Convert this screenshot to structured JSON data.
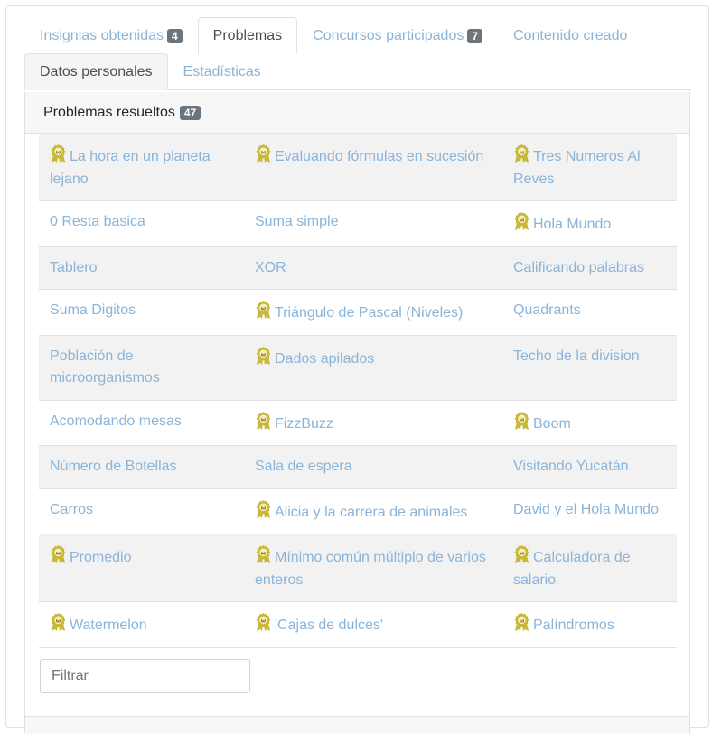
{
  "tabs": [
    {
      "label": "Insignias obtenidas",
      "badge": "4"
    },
    {
      "label": "Problemas"
    },
    {
      "label": "Concursos participados",
      "badge": "7"
    },
    {
      "label": "Contenido creado"
    },
    {
      "label": "Datos personales"
    },
    {
      "label": "Estadísticas"
    }
  ],
  "panel": {
    "title": "Problemas resueltos",
    "count": "47"
  },
  "rows": [
    [
      {
        "t": "La hora en un planeta lejano",
        "m": true
      },
      {
        "t": "Evaluando fórmulas en sucesión",
        "m": true
      },
      {
        "t": "Tres Numeros Al Reves",
        "m": true
      }
    ],
    [
      {
        "t": "0 Resta basica",
        "m": false
      },
      {
        "t": "Suma simple",
        "m": false
      },
      {
        "t": "Hola Mundo",
        "m": true
      }
    ],
    [
      {
        "t": "Tablero",
        "m": false
      },
      {
        "t": "XOR",
        "m": false
      },
      {
        "t": "Calificando palabras",
        "m": false
      }
    ],
    [
      {
        "t": "Suma Digitos",
        "m": false
      },
      {
        "t": "Triángulo de Pascal (Niveles)",
        "m": true
      },
      {
        "t": "Quadrants",
        "m": false
      }
    ],
    [
      {
        "t": "Población de microorganismos",
        "m": false
      },
      {
        "t": "Dados apilados",
        "m": true
      },
      {
        "t": "Techo de la division",
        "m": false
      }
    ],
    [
      {
        "t": "Acomodando mesas",
        "m": false
      },
      {
        "t": "FizzBuzz",
        "m": true
      },
      {
        "t": "Boom",
        "m": true
      }
    ],
    [
      {
        "t": "Número de Botellas",
        "m": false
      },
      {
        "t": "Sala de espera",
        "m": false
      },
      {
        "t": "Visitando Yucatán",
        "m": false
      }
    ],
    [
      {
        "t": "Carros",
        "m": false
      },
      {
        "t": "Alicia y la carrera de animales",
        "m": true
      },
      {
        "t": "David y el Hola Mundo",
        "m": false
      }
    ],
    [
      {
        "t": "Promedio",
        "m": true
      },
      {
        "t": "Mínimo común múltiplo de varios enteros",
        "m": true
      },
      {
        "t": "Calculadora de salario",
        "m": true
      }
    ],
    [
      {
        "t": "Watermelon",
        "m": true
      },
      {
        "t": "'Cajas de dulces'",
        "m": true
      },
      {
        "t": "Palíndromos",
        "m": true
      }
    ]
  ],
  "filter": {
    "placeholder": "Filtrar",
    "value": ""
  },
  "colors": {
    "link": "#8ab4d8",
    "medal": "#c8b836",
    "stripe": "#f2f2f2"
  },
  "icons": {
    "medal": "medal-ribbon-icon"
  }
}
